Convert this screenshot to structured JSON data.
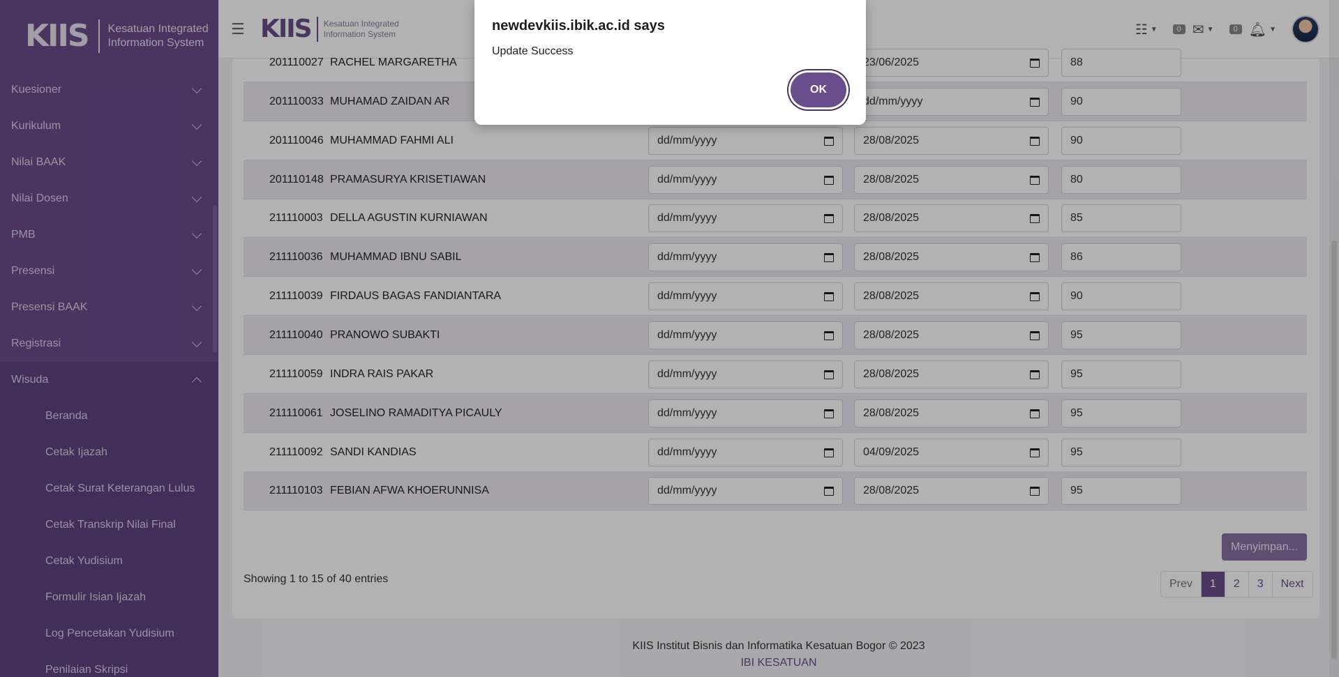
{
  "brand": {
    "logo": "KIIS",
    "line1": "Kesatuan Integrated",
    "line2": "Information System"
  },
  "header": {
    "logo": "KIIS",
    "line1": "Kesatuan Integrated",
    "line2": "Information System",
    "mail_count": "0",
    "notif_count": "0"
  },
  "sidebar": {
    "items": [
      {
        "label": "Kuesioner"
      },
      {
        "label": "Kurikulum"
      },
      {
        "label": "Nilai BAAK"
      },
      {
        "label": "Nilai Dosen"
      },
      {
        "label": "PMB"
      },
      {
        "label": "Presensi"
      },
      {
        "label": "Presensi BAAK"
      },
      {
        "label": "Registrasi"
      },
      {
        "label": "Wisuda"
      }
    ],
    "wisuda_sub": [
      {
        "label": "Beranda"
      },
      {
        "label": "Cetak Ijazah"
      },
      {
        "label": "Cetak Surat Keterangan Lulus"
      },
      {
        "label": "Cetak Transkrip Nilai Final"
      },
      {
        "label": "Cetak Yudisium"
      },
      {
        "label": "Formulir Isian Ijazah"
      },
      {
        "label": "Log Pencetakan Yudisium"
      },
      {
        "label": "Penilaian Skripsi"
      }
    ]
  },
  "table": {
    "rows": [
      {
        "nim": "201110027",
        "name": "RACHEL MARGARETHA",
        "date1": "",
        "date2": "23/06/2025",
        "score": "88"
      },
      {
        "nim": "201110033",
        "name": "MUHAMAD ZAIDAN AR",
        "date1": "",
        "date2": "dd/mm/yyyy",
        "score": "90"
      },
      {
        "nim": "201110046",
        "name": "MUHAMMAD FAHMI ALI",
        "date1": "dd/mm/yyyy",
        "date2": "28/08/2025",
        "score": "90"
      },
      {
        "nim": "201110148",
        "name": "PRAMASURYA KRISETIAWAN",
        "date1": "dd/mm/yyyy",
        "date2": "28/08/2025",
        "score": "80"
      },
      {
        "nim": "211110003",
        "name": "DELLA AGUSTIN KURNIAWAN",
        "date1": "dd/mm/yyyy",
        "date2": "28/08/2025",
        "score": "85"
      },
      {
        "nim": "211110036",
        "name": "MUHAMMAD IBNU SABIL",
        "date1": "dd/mm/yyyy",
        "date2": "28/08/2025",
        "score": "86"
      },
      {
        "nim": "211110039",
        "name": "FIRDAUS BAGAS FANDIANTARA",
        "date1": "dd/mm/yyyy",
        "date2": "28/08/2025",
        "score": "90"
      },
      {
        "nim": "211110040",
        "name": "PRANOWO SUBAKTI",
        "date1": "dd/mm/yyyy",
        "date2": "28/08/2025",
        "score": "95"
      },
      {
        "nim": "211110059",
        "name": "INDRA RAIS PAKAR",
        "date1": "dd/mm/yyyy",
        "date2": "28/08/2025",
        "score": "95"
      },
      {
        "nim": "211110061",
        "name": "JOSELINO RAMADITYA PICAULY",
        "date1": "dd/mm/yyyy",
        "date2": "28/08/2025",
        "score": "95"
      },
      {
        "nim": "211110092",
        "name": "SANDI KANDIAS",
        "date1": "dd/mm/yyyy",
        "date2": "04/09/2025",
        "score": "95"
      },
      {
        "nim": "211110103",
        "name": "FEBIAN AFWA KHOERUNNISA",
        "date1": "dd/mm/yyyy",
        "date2": "28/08/2025",
        "score": "95"
      }
    ]
  },
  "save_button": "Menyimpan...",
  "showing": "Showing 1 to 15 of 40 entries",
  "pagination": {
    "prev": "Prev",
    "pages": [
      "1",
      "2",
      "3"
    ],
    "next": "Next",
    "active": "1"
  },
  "footer": {
    "line1": "KIIS Institut Bisnis dan Informatika Kesatuan Bogor © 2023",
    "line2": "IBI KESATUAN"
  },
  "dialog": {
    "title": "newdevkiis.ibik.ac.id says",
    "message": "Update Success",
    "ok": "OK"
  }
}
